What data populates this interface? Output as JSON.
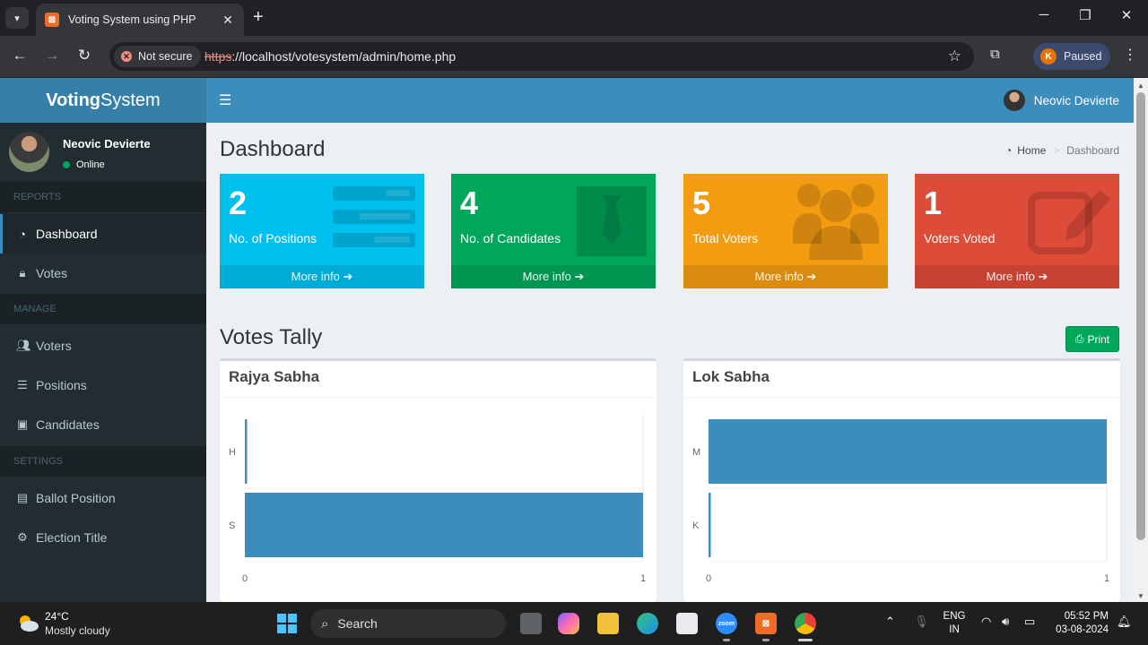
{
  "browser": {
    "tab_title": "Voting System using PHP",
    "tab_close": "✕",
    "new_tab": "+",
    "security_label": "Not secure",
    "url_scheme": "https",
    "url_rest": "://localhost/votesystem/admin/home.php",
    "profile_initial": "K",
    "profile_status": "Paused"
  },
  "app": {
    "logo_bold": "Voting",
    "logo_rest": "System",
    "user_name": "Neovic Devierte",
    "status": "Online"
  },
  "sidebar": {
    "reports_header": "REPORTS",
    "manage_header": "MANAGE",
    "settings_header": "SETTINGS",
    "items": [
      {
        "label": "Dashboard",
        "icon": "dashboard-icon"
      },
      {
        "label": "Votes",
        "icon": "lock-icon"
      },
      {
        "label": "Voters",
        "icon": "users-icon"
      },
      {
        "label": "Positions",
        "icon": "tasks-icon"
      },
      {
        "label": "Candidates",
        "icon": "black-tie-icon"
      },
      {
        "label": "Ballot Position",
        "icon": "file-text-icon"
      },
      {
        "label": "Election Title",
        "icon": "cog-icon"
      }
    ]
  },
  "main": {
    "title": "Dashboard",
    "breadcrumb_home": "Home",
    "breadcrumb_current": "Dashboard",
    "more_info": "More info",
    "stats": [
      {
        "value": "2",
        "label": "No. of Positions",
        "color": "#00c0ef"
      },
      {
        "value": "4",
        "label": "No. of Candidates",
        "color": "#00a65a"
      },
      {
        "value": "5",
        "label": "Total Voters",
        "color": "#f39c12"
      },
      {
        "value": "1",
        "label": "Voters Voted",
        "color": "#dd4b39"
      }
    ],
    "tally_title": "Votes Tally",
    "print_label": "Print"
  },
  "chart_data": [
    {
      "type": "bar",
      "orientation": "horizontal",
      "title": "Rajya Sabha",
      "categories": [
        "H",
        "S"
      ],
      "values": [
        0,
        1
      ],
      "xlim": [
        0,
        1
      ],
      "ticks": [
        "0",
        "1"
      ],
      "color": "#3c8dbc"
    },
    {
      "type": "bar",
      "orientation": "horizontal",
      "title": "Lok Sabha",
      "categories": [
        "M",
        "K"
      ],
      "values": [
        1,
        0
      ],
      "xlim": [
        0,
        1
      ],
      "ticks": [
        "0",
        "1"
      ],
      "color": "#3c8dbc"
    }
  ],
  "taskbar": {
    "temp": "24°C",
    "weather": "Mostly cloudy",
    "search_placeholder": "Search",
    "lang_1": "ENG",
    "lang_2": "IN",
    "time": "05:52 PM",
    "date": "03-08-2024"
  }
}
